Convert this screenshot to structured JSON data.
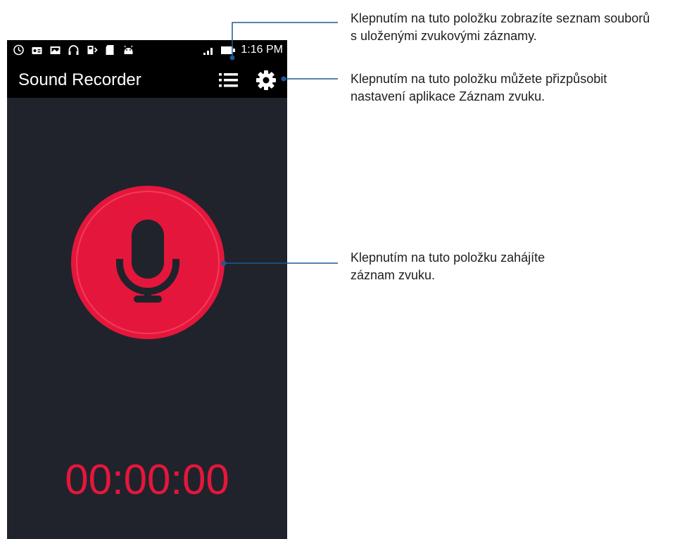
{
  "status_bar": {
    "time": "1:16 PM",
    "icons": [
      "clock-icon",
      "radio-icon",
      "gallery-icon",
      "headset-icon",
      "battery-saver-icon",
      "sd-card-icon",
      "android-icon",
      "signal-icon",
      "battery-icon"
    ]
  },
  "app_bar": {
    "title": "Sound Recorder",
    "actions": [
      "list-icon",
      "gear-icon"
    ]
  },
  "recorder": {
    "timer": "00:00:00",
    "icon": "microphone-icon",
    "accent_color": "#e5163c",
    "background_color": "#20232b"
  },
  "callouts": [
    {
      "line1": "Klepnutím na tuto položku zobrazíte seznam souborů",
      "line2": "s uloženými zvukovými záznamy."
    },
    {
      "line1": "Klepnutím na tuto položku můžete přizpůsobit",
      "line2": "nastavení aplikace Záznam zvuku."
    },
    {
      "line1": "Klepnutím na tuto položku zahájíte",
      "line2": "záznam zvuku."
    }
  ],
  "callout_line_color": "#1a5a96"
}
